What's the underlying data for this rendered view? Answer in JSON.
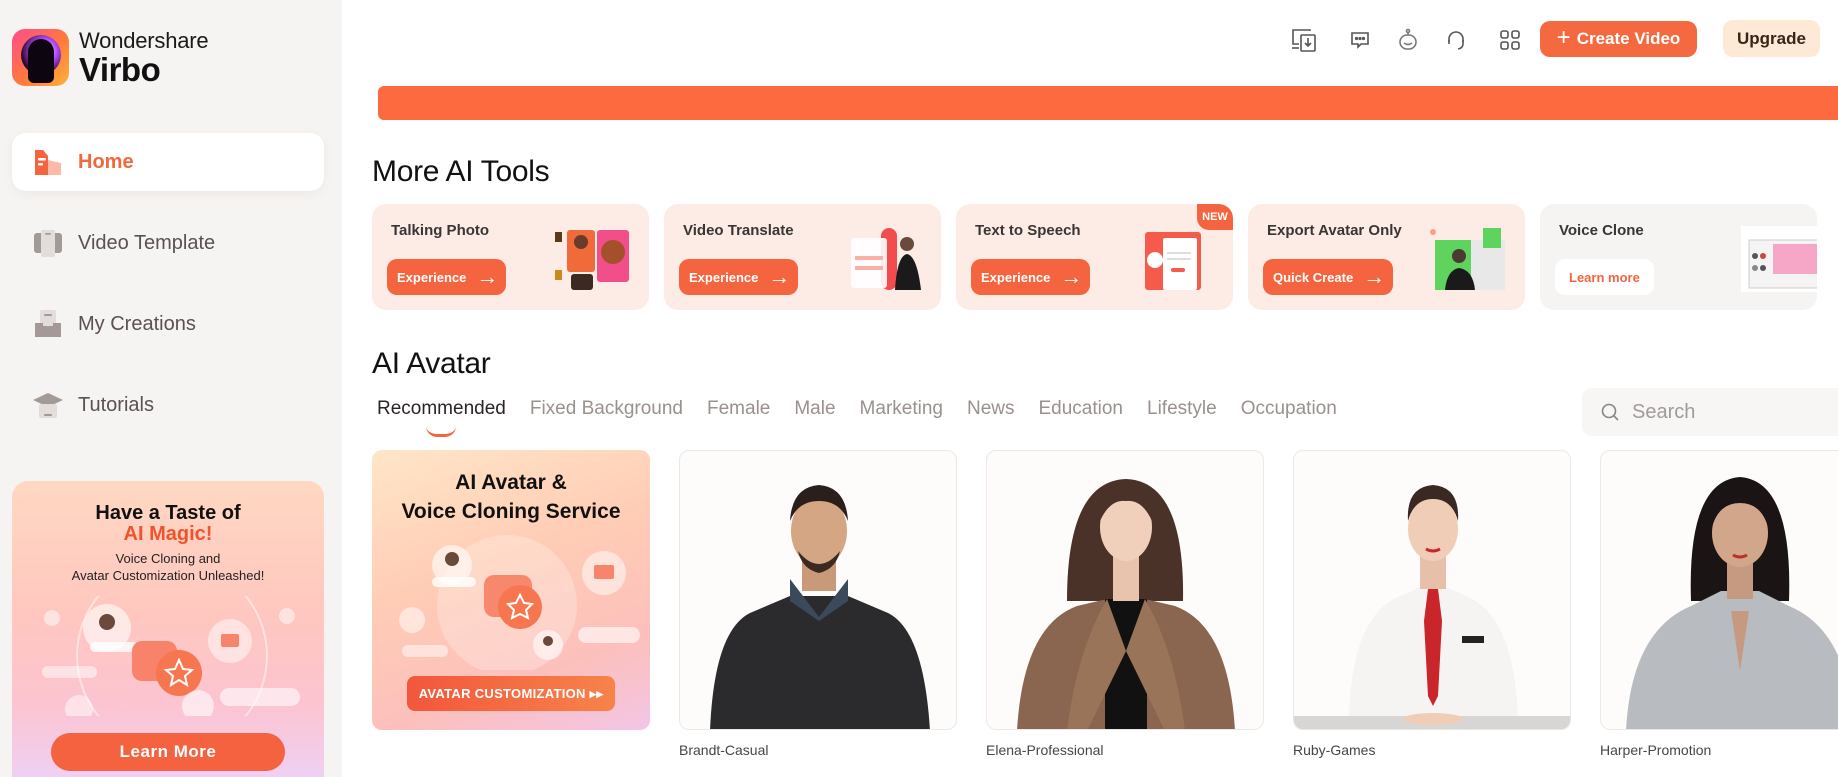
{
  "app": {
    "brand_top": "Wondershare",
    "brand_bottom": "Virbo"
  },
  "sidebar": {
    "items": [
      {
        "label": "Home",
        "icon": "home-icon",
        "active": true
      },
      {
        "label": "Video Template",
        "icon": "video-template-icon",
        "active": false
      },
      {
        "label": "My Creations",
        "icon": "my-creations-icon",
        "active": false
      },
      {
        "label": "Tutorials",
        "icon": "graduation-cap-icon",
        "active": false
      }
    ],
    "promo": {
      "title_line1": "Have a Taste of",
      "title_line2": "AI Magic!",
      "subtitle_line1": "Voice Cloning and",
      "subtitle_line2": "Avatar Customization Unleashed!",
      "button": "Learn More"
    }
  },
  "topbar": {
    "icons": [
      "download-device-icon",
      "chat-icon",
      "robot-icon",
      "headset-icon",
      "apps-grid-icon"
    ],
    "create_button": "Create Video",
    "upgrade_button": "Upgrade"
  },
  "main": {
    "banner_color": "#fd6a3f",
    "tools_title": "More AI Tools",
    "tools": [
      {
        "name": "Talking Photo",
        "button": "Experience",
        "is_new": false
      },
      {
        "name": "Video Translate",
        "button": "Experience",
        "is_new": false
      },
      {
        "name": "Text to Speech",
        "button": "Experience",
        "is_new": true,
        "badge": "NEW"
      },
      {
        "name": "Export Avatar Only",
        "button": "Quick Create",
        "is_new": false
      },
      {
        "name": "Voice Clone",
        "button": "Learn more",
        "is_new": false
      }
    ],
    "avatar_title": "AI Avatar",
    "tabs": [
      "Recommended",
      "Fixed Background",
      "Female",
      "Male",
      "Marketing",
      "News",
      "Education",
      "Lifestyle",
      "Occupation"
    ],
    "active_tab": "Recommended",
    "search": {
      "placeholder": "Search",
      "value": ""
    },
    "promo_card": {
      "title_line1": "AI Avatar &",
      "title_line2": "Voice Cloning Service",
      "button": "AVATAR CUSTOMIZATION ▸▸"
    },
    "avatars": [
      {
        "name": "Brandt-Casual"
      },
      {
        "name": "Elena-Professional"
      },
      {
        "name": "Ruby-Games"
      },
      {
        "name": "Harper-Promotion"
      }
    ]
  },
  "colors": {
    "accent": "#f4643e",
    "sidebar_bg": "#f6f4f2",
    "tool_card_bg": "#fdebe5",
    "upgrade_bg": "#fde9d6"
  }
}
